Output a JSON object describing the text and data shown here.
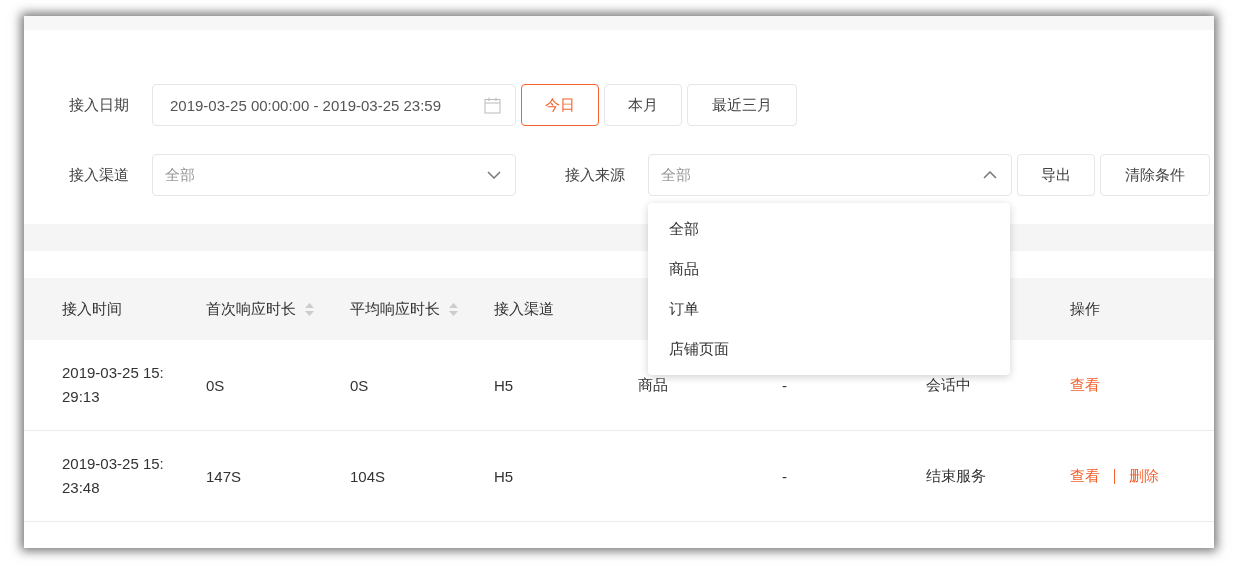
{
  "filters": {
    "date": {
      "label": "接入日期",
      "value": "2019-03-25 00:00:00 - 2019-03-25 23:59",
      "quick_ranges": [
        {
          "label": "今日",
          "selected": true
        },
        {
          "label": "本月",
          "selected": false
        },
        {
          "label": "最近三月",
          "selected": false
        }
      ]
    },
    "channel": {
      "label": "接入渠道",
      "placeholder": "全部",
      "open": false
    },
    "source": {
      "label": "接入来源",
      "placeholder": "全部",
      "open": true,
      "options": [
        {
          "label": "全部"
        },
        {
          "label": "商品"
        },
        {
          "label": "订单"
        },
        {
          "label": "店铺页面"
        }
      ]
    },
    "buttons": [
      "导出",
      "清除条件"
    ]
  },
  "table": {
    "columns": [
      {
        "label": "接入时间",
        "sortable": false
      },
      {
        "label": "首次响应时长",
        "sortable": true
      },
      {
        "label": "平均响应时长",
        "sortable": true
      },
      {
        "label": "接入渠道",
        "sortable": false
      },
      {},
      {},
      {},
      {
        "label": "操作",
        "sortable": false
      }
    ],
    "rows": [
      {
        "cells": [
          "2019-03-25 15:29:13",
          "0S",
          "0S",
          "H5",
          "商品",
          "-",
          "会话中"
        ],
        "actions": [
          "查看"
        ]
      },
      {
        "cells": [
          "2019-03-25 15:23:48",
          "147S",
          "104S",
          "H5",
          "",
          "-",
          "结束服务"
        ],
        "actions": [
          "查看",
          "删除"
        ]
      }
    ]
  }
}
